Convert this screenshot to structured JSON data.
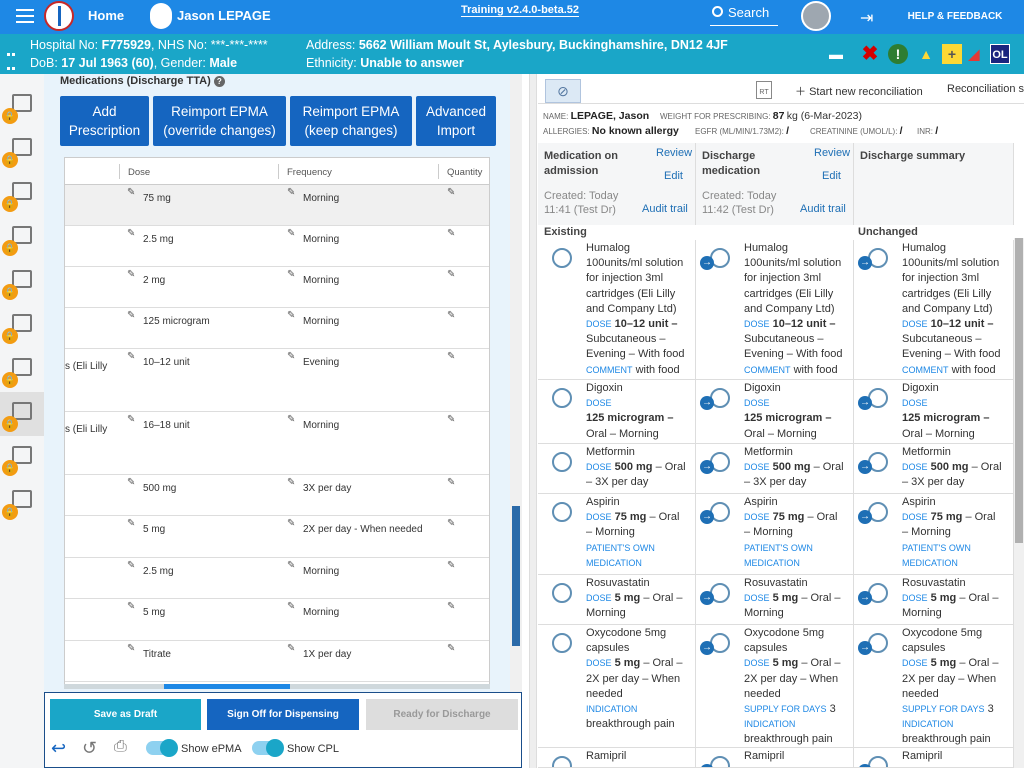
{
  "header": {
    "home": "Home",
    "user": "Jason LEPAGE",
    "training": "Training v2.4.0-beta.52",
    "search": "Search",
    "help": "HELP & FEEDBACK"
  },
  "patient": {
    "hospital_no_label": "Hospital No:",
    "hospital_no": "F775929",
    "nhs_label": "NHS No:",
    "nhs": "***-***-****",
    "dob_label": "DoB:",
    "dob": "17 Jul 1963 (60)",
    "gender_label": "Gender:",
    "gender": "Male",
    "address_label": "Address:",
    "address": "5662 William Moult St, Aylesbury, Buckinghamshire, DN12 4JF",
    "ethnicity_label": "Ethnicity:",
    "ethnicity": "Unable to answer",
    "badge": "OL"
  },
  "left": {
    "section_title": "Medications (Discharge TTA)",
    "buttons": [
      "Add Prescription",
      "Reimport EPMA (override changes)",
      "Reimport EPMA (keep changes)",
      "Advanced Import"
    ],
    "columns": [
      "Dose",
      "Frequency",
      "Quantity"
    ],
    "rows": [
      {
        "name": "",
        "dose": "75 mg",
        "freq": "Morning"
      },
      {
        "name": "",
        "dose": "2.5 mg",
        "freq": "Morning"
      },
      {
        "name": "",
        "dose": "2 mg",
        "freq": "Morning"
      },
      {
        "name": "",
        "dose": "125 microgram",
        "freq": "Morning"
      },
      {
        "name": "s (Eli Lilly",
        "dose": "10–12 unit",
        "freq": "Evening"
      },
      {
        "name": "s (Eli Lilly",
        "dose": "16–18 unit",
        "freq": "Morning"
      },
      {
        "name": "",
        "dose": "500 mg",
        "freq": "3X per day"
      },
      {
        "name": "",
        "dose": "5 mg",
        "freq": "2X per day - When needed"
      },
      {
        "name": "",
        "dose": "2.5 mg",
        "freq": "Morning"
      },
      {
        "name": "",
        "dose": "5 mg",
        "freq": "Morning"
      },
      {
        "name": "",
        "dose": "Titrate",
        "freq": "1X per day"
      }
    ],
    "bottom": {
      "save": "Save as Draft",
      "signoff": "Sign Off for Dispensing",
      "ready": "Ready for Discharge",
      "show_epma": "Show ePMA",
      "show_cpl": "Show CPL"
    }
  },
  "right": {
    "start_reconciliation": "Start new reconciliation",
    "reconciliation_s": "Reconciliation s",
    "name_label": "NAME:",
    "name": "LEPAGE, Jason",
    "weight_label": "WEIGHT FOR PRESCRIBING:",
    "weight": "87",
    "weight_unit": "kg (6-Mar-2023)",
    "allergies_label": "ALLERGIES:",
    "allergies": "No known allergy",
    "egfr_label": "EGFR (ML/MIN/1.73M2):",
    "egfr": "/",
    "creat_label": "CREATININE (UMOL/L):",
    "creat": "/",
    "inr_label": "INR:",
    "inr": "/",
    "columns": [
      {
        "title": "Medication on admission",
        "review": "Review",
        "edit": "Edit",
        "created": "Created: Today",
        "time": "11:41 (Test Dr)",
        "audit": "Audit trail"
      },
      {
        "title": "Discharge medication",
        "review": "Review",
        "edit": "Edit",
        "created": "Created: Today",
        "time": "11:42 (Test Dr)",
        "audit": "Audit trail"
      },
      {
        "title": "Discharge summary"
      }
    ],
    "groups": [
      "Existing",
      "Unchanged"
    ],
    "meds": [
      [
        "Humalog 100units/ml solution for injection 3ml cartridges (Eli Lilly and Company Ltd)",
        "DOSE",
        "10–12 unit –",
        "Subcutaneous – Evening – With food",
        "COMMENT",
        "with food"
      ],
      [
        "Digoxin",
        "DOSE",
        "125 microgram –",
        "Oral – Morning"
      ],
      [
        "Metformin",
        "DOSE",
        "500 mg",
        "– Oral – 3X per day"
      ],
      [
        "Aspirin",
        "DOSE",
        "75 mg",
        "– Oral – Morning",
        "PATIENT'S OWN MEDICATION"
      ],
      [
        "Rosuvastatin",
        "DOSE",
        "5 mg",
        "– Oral – Morning"
      ],
      [
        "Oxycodone 5mg capsules",
        "DOSE",
        "5 mg",
        "– Oral – 2X per day – When needed",
        "INDICATION",
        "breakthrough pain"
      ],
      [
        "Ramipril"
      ]
    ],
    "oxy_supply": "SUPPLY FOR DAYS",
    "oxy_supply_val": "3"
  }
}
